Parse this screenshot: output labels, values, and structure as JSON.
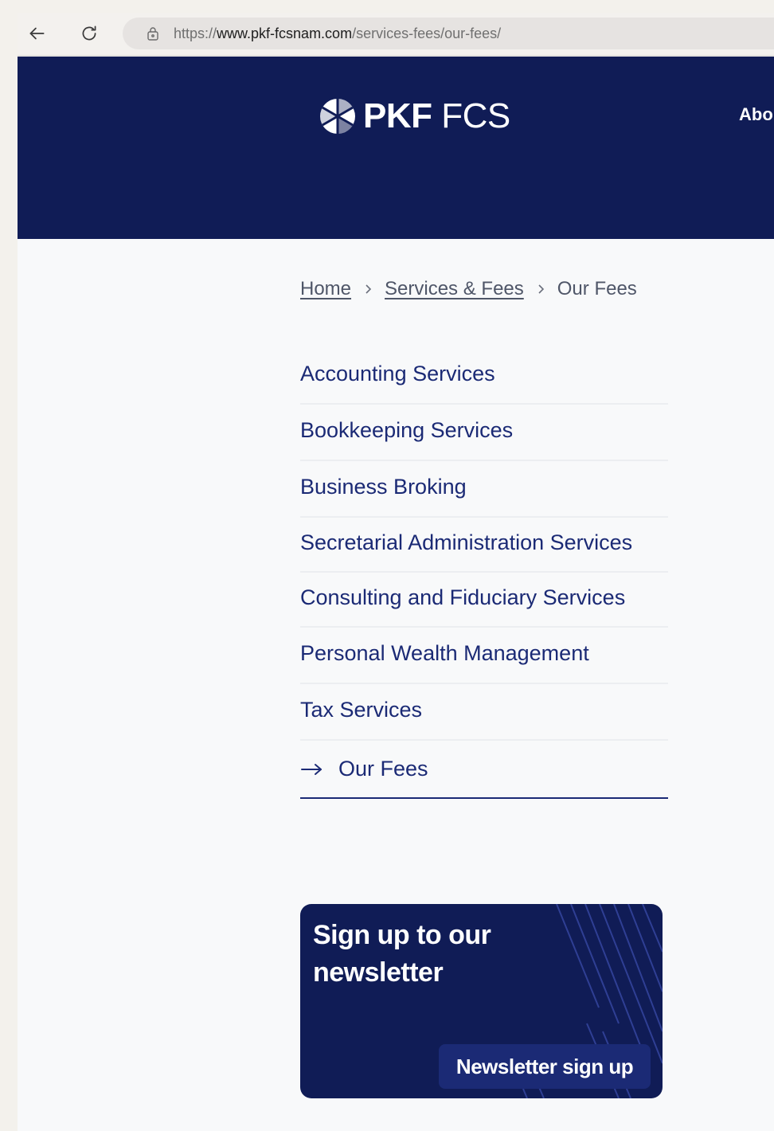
{
  "browser": {
    "url_scheme": "https://",
    "url_host": "www.pkf-fcsnam.com",
    "url_path": "/services-fees/our-fees/"
  },
  "header": {
    "logo_bold": "PKF",
    "logo_light": "FCS",
    "nav_partial": "Abo",
    "background_color": "#101c56"
  },
  "breadcrumb": {
    "home": "Home",
    "services": "Services & Fees",
    "current": "Our Fees"
  },
  "menu": {
    "items": [
      {
        "label": "Accounting Services"
      },
      {
        "label": "Bookkeeping Services"
      },
      {
        "label": "Business Broking"
      },
      {
        "label": "Secretarial Administration Services"
      },
      {
        "label": "Consulting and Fiduciary Services"
      },
      {
        "label": "Personal Wealth Management"
      },
      {
        "label": "Tax Services"
      }
    ],
    "active": {
      "label": "Our Fees"
    },
    "link_color": "#1b2a75"
  },
  "newsletter": {
    "title": "Sign up to our newsletter",
    "button_label": "Newsletter sign up"
  }
}
